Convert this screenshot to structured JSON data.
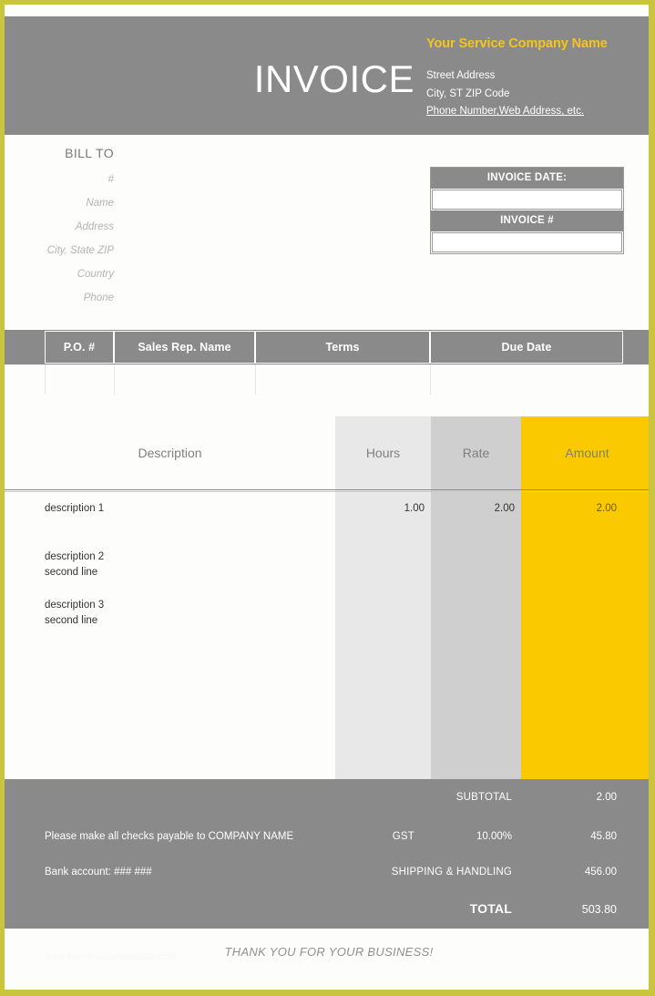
{
  "document": {
    "title_word": "INVOICE",
    "accent_yellow": "#fbc900",
    "accent_gold_text": "#f6c518",
    "gray_band": "#8a8a8a",
    "frame_olive": "#c9c53e"
  },
  "company": {
    "name": "Your Service Company Name",
    "street": "Street Address",
    "city_state_zip": "City, ST  ZIP Code",
    "contact": "Phone Number,Web Address, etc."
  },
  "bill_to": {
    "title": "BILL TO",
    "lines": [
      "#",
      "Name",
      "Address",
      "City, State ZIP",
      "Country",
      "Phone"
    ]
  },
  "meta": {
    "date_label": "INVOICE DATE:",
    "date_value": "",
    "number_label": "INVOICE #",
    "number_value": ""
  },
  "po_header": {
    "columns": [
      "P.O. #",
      "Sales Rep. Name",
      "Terms",
      "Due Date"
    ],
    "values": [
      "",
      "",
      "",
      ""
    ]
  },
  "items_table": {
    "headers": [
      "Description",
      "Hours",
      "Rate",
      "Amount"
    ],
    "rows": [
      {
        "description": "description 1",
        "hours": "1.00",
        "rate": "2.00",
        "amount": "2.00"
      },
      {
        "description": "description 2\nsecond line",
        "hours": "",
        "rate": "",
        "amount": ""
      },
      {
        "description": "description 3\nsecond line",
        "hours": "",
        "rate": "",
        "amount": ""
      },
      {
        "description": "",
        "hours": "",
        "rate": "",
        "amount": ""
      },
      {
        "description": "",
        "hours": "",
        "rate": "",
        "amount": ""
      },
      {
        "description": "",
        "hours": "",
        "rate": "",
        "amount": ""
      }
    ]
  },
  "totals": {
    "subtotal_label": "SUBTOTAL",
    "subtotal_value": "2.00",
    "tax_label": "GST",
    "tax_rate": "10.00%",
    "tax_value": "45.80",
    "shipping_label": "SHIPPING & HANDLING",
    "shipping_value": "456.00",
    "total_label": "TOTAL",
    "total_value": "503.80",
    "note_checks": "Please make all checks payable to COMPANY NAME",
    "note_bank": "Bank account: ### ###"
  },
  "footer": {
    "thanks": "THANK YOU FOR YOUR BUSINESS!",
    "watermark": "www.free-invoice-template.com"
  }
}
